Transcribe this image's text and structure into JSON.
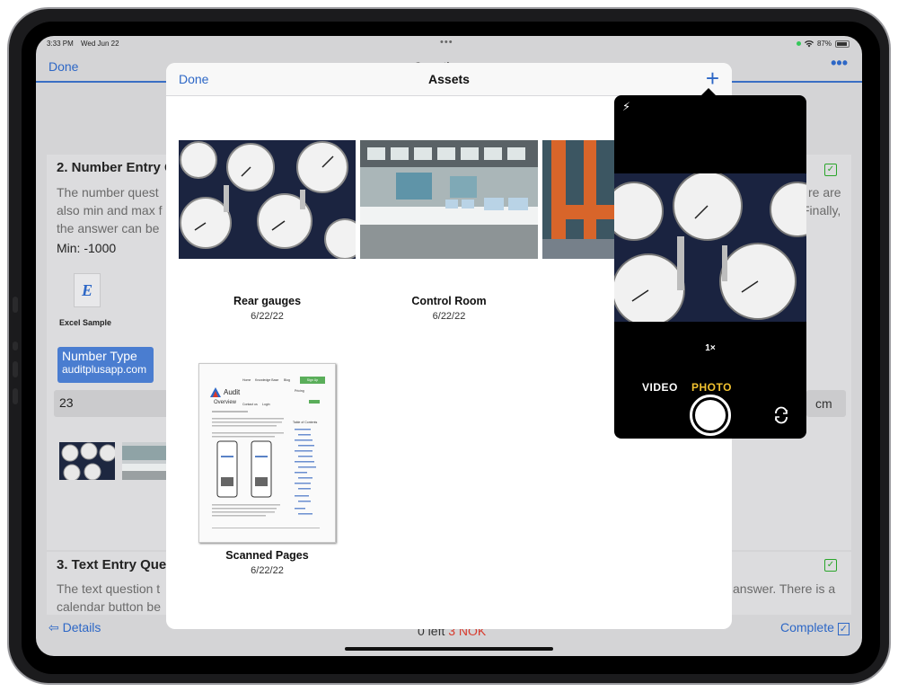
{
  "status_bar": {
    "time": "3:33 PM",
    "date": "Wed Jun 22",
    "battery": "87%"
  },
  "nav": {
    "done": "Done",
    "title": "Questions",
    "more": "•••"
  },
  "question2": {
    "title": "2. Number Entry Q",
    "text_lines_left": [
      "The number quest",
      "also min and max f",
      "the answer can be"
    ],
    "text_lines_right": [
      "re are",
      "Finally,"
    ],
    "min": "Min: -1000",
    "excel_icon_glyph": "E",
    "excel_label": "Excel Sample",
    "number_type": "Number Type",
    "number_site": "auditplusapp.com",
    "input_value": "23",
    "unit": "cm"
  },
  "question3": {
    "title": "3. Text Entry Ques",
    "text_lines_left": [
      "The text question t",
      "calendar button be"
    ],
    "text_lines_right": [
      "answer.  There is a"
    ]
  },
  "bottom": {
    "details": "Details",
    "left_count": "0 left",
    "nok": "3 NOK",
    "complete": "Complete"
  },
  "modal": {
    "done": "Done",
    "title": "Assets",
    "add": "+",
    "assets": [
      {
        "name": "Rear gauges",
        "date": "6/22/22"
      },
      {
        "name": "Control Room",
        "date": "6/22/22"
      },
      {
        "name": "",
        "date": ""
      },
      {
        "name": "Scanned Pages",
        "date": "6/22/22"
      }
    ],
    "doc": {
      "brand": "Audit",
      "nav": [
        "Home",
        "Knowledge Base",
        "Blog"
      ],
      "signup": "Sign Up",
      "heading": "Overview",
      "links": [
        "Contact us",
        "Login"
      ],
      "pricing": "Pricing",
      "toc_title": "Table of Contents"
    }
  },
  "camera": {
    "zoom": "1×",
    "modes": [
      "VIDEO",
      "PHOTO"
    ],
    "active_mode": "PHOTO",
    "accent": "#f2c230"
  },
  "colors": {
    "link": "#2d67c6",
    "nok": "#d83a2d",
    "check": "#2aa52a"
  },
  "icons": [
    "lightning-icon",
    "plus-icon",
    "flip-camera-icon",
    "shutter-button",
    "back-arrow-icon",
    "checkbox-icon",
    "more-icon",
    "wifi-icon",
    "battery-icon"
  ]
}
